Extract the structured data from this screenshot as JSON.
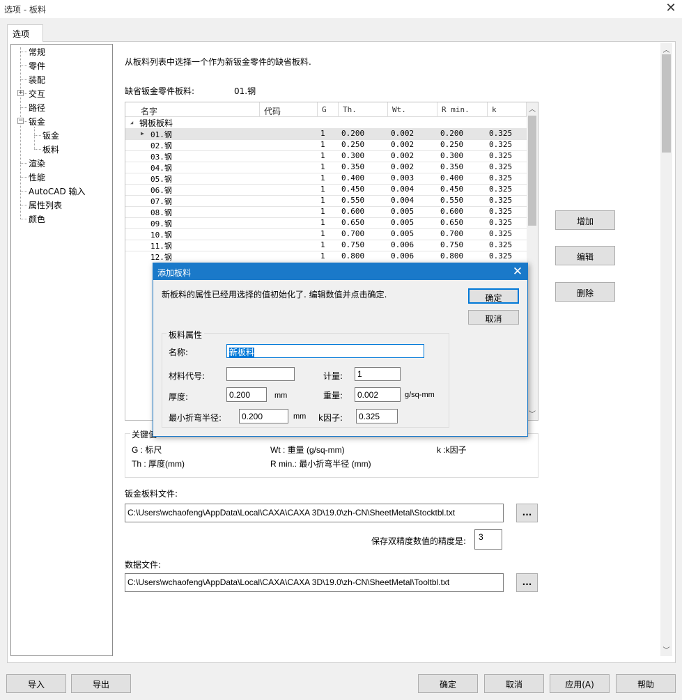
{
  "window": {
    "title": "选项 - 板料",
    "close_glyph": "✕"
  },
  "tabs": [
    {
      "label": "选项"
    }
  ],
  "tree": {
    "items": [
      {
        "label": "常规"
      },
      {
        "label": "零件"
      },
      {
        "label": "装配"
      },
      {
        "label": "交互"
      },
      {
        "label": "路径"
      },
      {
        "label": "钣金"
      },
      {
        "label": "钣金"
      },
      {
        "label": "板料"
      },
      {
        "label": "渲染"
      },
      {
        "label": "性能"
      },
      {
        "label": "AutoCAD 输入"
      },
      {
        "label": "属性列表"
      },
      {
        "label": "颜色"
      }
    ],
    "expand_plus": "+",
    "expand_minus": "−"
  },
  "content": {
    "instruction": "从板料列表中选择一个作为新钣金零件的缺省板料.",
    "default_label": "缺省钣金零件板料:",
    "default_value": "01.钢"
  },
  "grid": {
    "columns": [
      "名字",
      "代码",
      "G",
      "Th.",
      "Wt.",
      "R min.",
      "k"
    ],
    "group_label": "钢板板料",
    "group_arrow": "◢",
    "row_arrow": "▶",
    "rows": [
      [
        "01.钢",
        "",
        "1",
        "0.200",
        "0.002",
        "0.200",
        "0.325"
      ],
      [
        "02.钢",
        "",
        "1",
        "0.250",
        "0.002",
        "0.250",
        "0.325"
      ],
      [
        "03.钢",
        "",
        "1",
        "0.300",
        "0.002",
        "0.300",
        "0.325"
      ],
      [
        "04.钢",
        "",
        "1",
        "0.350",
        "0.002",
        "0.350",
        "0.325"
      ],
      [
        "05.钢",
        "",
        "1",
        "0.400",
        "0.003",
        "0.400",
        "0.325"
      ],
      [
        "06.钢",
        "",
        "1",
        "0.450",
        "0.004",
        "0.450",
        "0.325"
      ],
      [
        "07.钢",
        "",
        "1",
        "0.550",
        "0.004",
        "0.550",
        "0.325"
      ],
      [
        "08.钢",
        "",
        "1",
        "0.600",
        "0.005",
        "0.600",
        "0.325"
      ],
      [
        "09.钢",
        "",
        "1",
        "0.650",
        "0.005",
        "0.650",
        "0.325"
      ],
      [
        "10.钢",
        "",
        "1",
        "0.700",
        "0.005",
        "0.700",
        "0.325"
      ],
      [
        "11.钢",
        "",
        "1",
        "0.750",
        "0.006",
        "0.750",
        "0.325"
      ],
      [
        "12.钢",
        "",
        "1",
        "0.800",
        "0.006",
        "0.800",
        "0.325"
      ]
    ],
    "scroll_up": "︿",
    "scroll_down": "﹀"
  },
  "side_buttons": {
    "add": "增加",
    "edit": "编辑",
    "delete": "删除"
  },
  "key_values": {
    "title": "关键值",
    "g": "G : 标尺",
    "wt": "Wt : 重量 (g/sq-mm)",
    "k": "k :k因子",
    "th": "Th : 厚度(mm)",
    "rmin": "R min.: 最小折弯半径 (mm)"
  },
  "stock_file": {
    "label": "钣金板料文件:",
    "path": "C:\\Users\\wchaofeng\\AppData\\Local\\CAXA\\CAXA 3D\\19.0\\zh-CN\\SheetMetal\\Stocktbl.txt",
    "browse": "..."
  },
  "precision": {
    "label": "保存双精度数值的精度是:",
    "value": "3"
  },
  "data_file": {
    "label": "数据文件:",
    "path": "C:\\Users\\wchaofeng\\AppData\\Local\\CAXA\\CAXA 3D\\19.0\\zh-CN\\SheetMetal\\Tooltbl.txt",
    "browse": "..."
  },
  "main_scroll": {
    "up": "︿",
    "down": "﹀"
  },
  "bottom_buttons": {
    "import": "导入",
    "export": "导出",
    "ok": "确定",
    "cancel": "取消",
    "apply": "应用(A)",
    "help": "帮助"
  },
  "dialog": {
    "title": "添加板料",
    "close_glyph": "✕",
    "message": "新板料的属性已经用选择的值初始化了. 编辑数值并点击确定.",
    "ok": "确定",
    "cancel": "取消",
    "group_title": "板料属性",
    "name_label": "名称:",
    "name_value": "新板料",
    "code_label": "材料代号:",
    "code_value": "",
    "gauge_label": "计量:",
    "gauge_value": "1",
    "thickness_label": "厚度:",
    "thickness_value": "0.200",
    "thickness_unit": "mm",
    "weight_label": "重量:",
    "weight_value": "0.002",
    "weight_unit": "g/sq-mm",
    "min_radius_label": "最小折弯半径:",
    "min_radius_value": "0.200",
    "min_radius_unit": "mm",
    "k_label": "k因子:",
    "k_value": "0.325"
  },
  "colors": {
    "accent": "#0078d7",
    "dialog_title": "#1a79c9"
  }
}
